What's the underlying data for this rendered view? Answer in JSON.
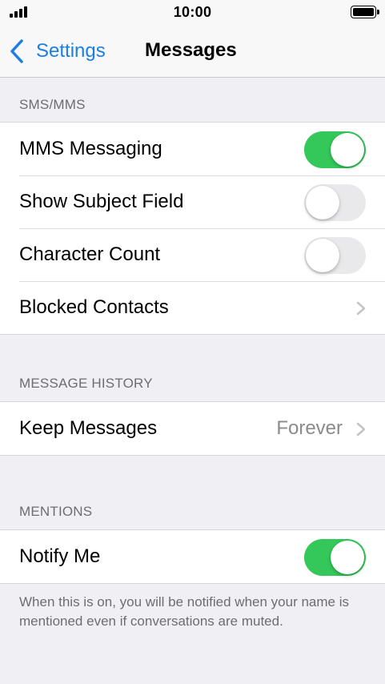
{
  "status_bar": {
    "time": "10:00"
  },
  "nav": {
    "back_label": "Settings",
    "title": "Messages"
  },
  "sections": {
    "sms_mms": {
      "header": "SMS/MMS",
      "mms_messaging": {
        "label": "MMS Messaging",
        "on": true
      },
      "show_subject_field": {
        "label": "Show Subject Field",
        "on": false
      },
      "character_count": {
        "label": "Character Count",
        "on": false
      },
      "blocked_contacts": {
        "label": "Blocked Contacts"
      }
    },
    "message_history": {
      "header": "MESSAGE HISTORY",
      "keep_messages": {
        "label": "Keep Messages",
        "value": "Forever"
      }
    },
    "mentions": {
      "header": "MENTIONS",
      "notify_me": {
        "label": "Notify Me",
        "on": true
      },
      "footer": "When this is on, you will be notified when your name is mentioned even if conversations are muted."
    }
  },
  "icons": {
    "back": "chevron-left-icon",
    "disclosure": "chevron-right-icon",
    "signal": "signal-icon",
    "battery": "battery-icon"
  },
  "colors": {
    "accent": "#1a7fe5",
    "toggle_on": "#34c759",
    "toggle_off": "#e9e9eb",
    "background": "#efeff4",
    "secondary_text": "#6d6d72"
  }
}
